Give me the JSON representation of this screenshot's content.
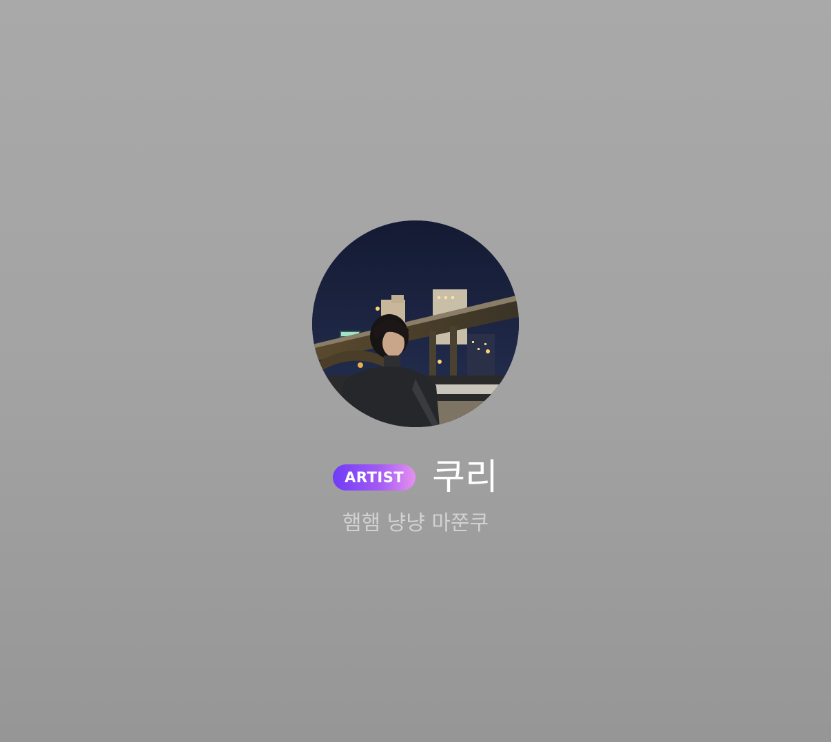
{
  "profile": {
    "badge_label": "ARTIST",
    "name": "쿠리",
    "bio": "햄햄 냥냥 마쭌쿠",
    "avatar_icon": "profile-photo",
    "colors": {
      "background": "#a5a5a5",
      "badge_start": "#6f3cf6",
      "badge_end": "#e590f0",
      "name_text": "#ffffff",
      "bio_text": "#d2d2d2"
    }
  }
}
